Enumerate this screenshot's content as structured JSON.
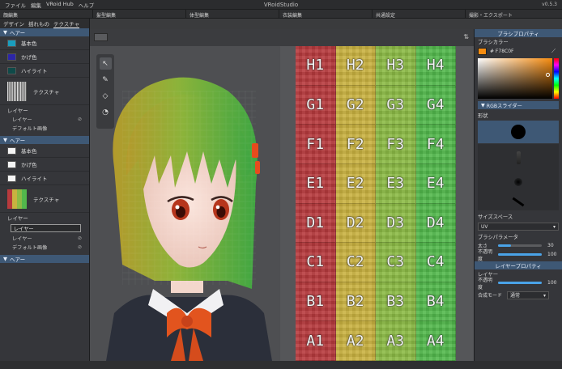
{
  "window": {
    "title": "VRoidStudio",
    "version": "v0.5.3"
  },
  "menu": [
    "ファイル",
    "編集",
    "VRoid Hub",
    "ヘルプ"
  ],
  "mode_tabs": [
    "顔編集",
    "髪型編集",
    "体型編集",
    "衣装編集",
    "共通設定",
    "撮影・エクスポート"
  ],
  "left_panel": {
    "tabs": [
      "デザイン",
      "揺れもの",
      "テクスチャ"
    ],
    "active_tab": "テクスチャ",
    "sections": [
      {
        "title": "ヘアー",
        "colors": [
          {
            "label": "基本色",
            "color": "#1a9dbd"
          },
          {
            "label": "かげ色",
            "color": "#2c26a8"
          },
          {
            "label": "ハイライト",
            "color": "#0f4a49"
          }
        ],
        "texture_label": "テクスチャ",
        "layer_label": "レイヤー",
        "layers": [
          "レイヤー",
          "デフォルト画像"
        ]
      },
      {
        "title": "ヘアー",
        "colors": [
          {
            "label": "基本色",
            "color": "#f4f4f4"
          },
          {
            "label": "かげ色",
            "color": "#f4f4f4"
          },
          {
            "label": "ハイライト",
            "color": "#f4f4f4"
          }
        ],
        "texture_label": "テクスチャ",
        "layer_label": "レイヤー",
        "layer_input": "レイヤー",
        "layers": [
          "レイヤー",
          "デフォルト画像"
        ]
      },
      {
        "title": "ヘアー"
      }
    ]
  },
  "texture_grid": {
    "rows": [
      [
        "H1",
        "H2",
        "H3",
        "H4"
      ],
      [
        "G1",
        "G2",
        "G3",
        "G4"
      ],
      [
        "F1",
        "F2",
        "F3",
        "F4"
      ],
      [
        "E1",
        "E2",
        "E3",
        "E4"
      ],
      [
        "D1",
        "D2",
        "D3",
        "D4"
      ],
      [
        "C1",
        "C2",
        "C3",
        "C4"
      ],
      [
        "B1",
        "B2",
        "B3",
        "B4"
      ],
      [
        "A1",
        "A2",
        "A3",
        "A4"
      ]
    ],
    "column_colors": [
      "#b73a3d",
      "#c9b240",
      "#8cbb46",
      "#52b84c"
    ]
  },
  "right_panel": {
    "brush_props_title": "ブラシプロパティ",
    "brush_color_label": "ブラシカラー",
    "brush_color_hex": "# F78C0F",
    "brush_color": "#f78c0f",
    "rgb_slider_label": "RGBスライダー",
    "shape_label": "形状",
    "size_space_label": "サイズスペース",
    "size_space_value": "UV",
    "brush_params_label": "ブラシパラメータ",
    "thickness_label": "太さ",
    "thickness_value": "30",
    "thickness_level": 0.3,
    "opacity_label": "不透明度",
    "opacity_value": "100",
    "opacity_level": 1.0,
    "layer_props_title": "レイヤープロパティ",
    "layer_label": "レイヤー",
    "layer_opacity_label": "不透明度",
    "layer_opacity_value": "100",
    "layer_opacity_level": 1.0,
    "blend_mode_label": "合成モード",
    "blend_mode_value": "通常"
  }
}
